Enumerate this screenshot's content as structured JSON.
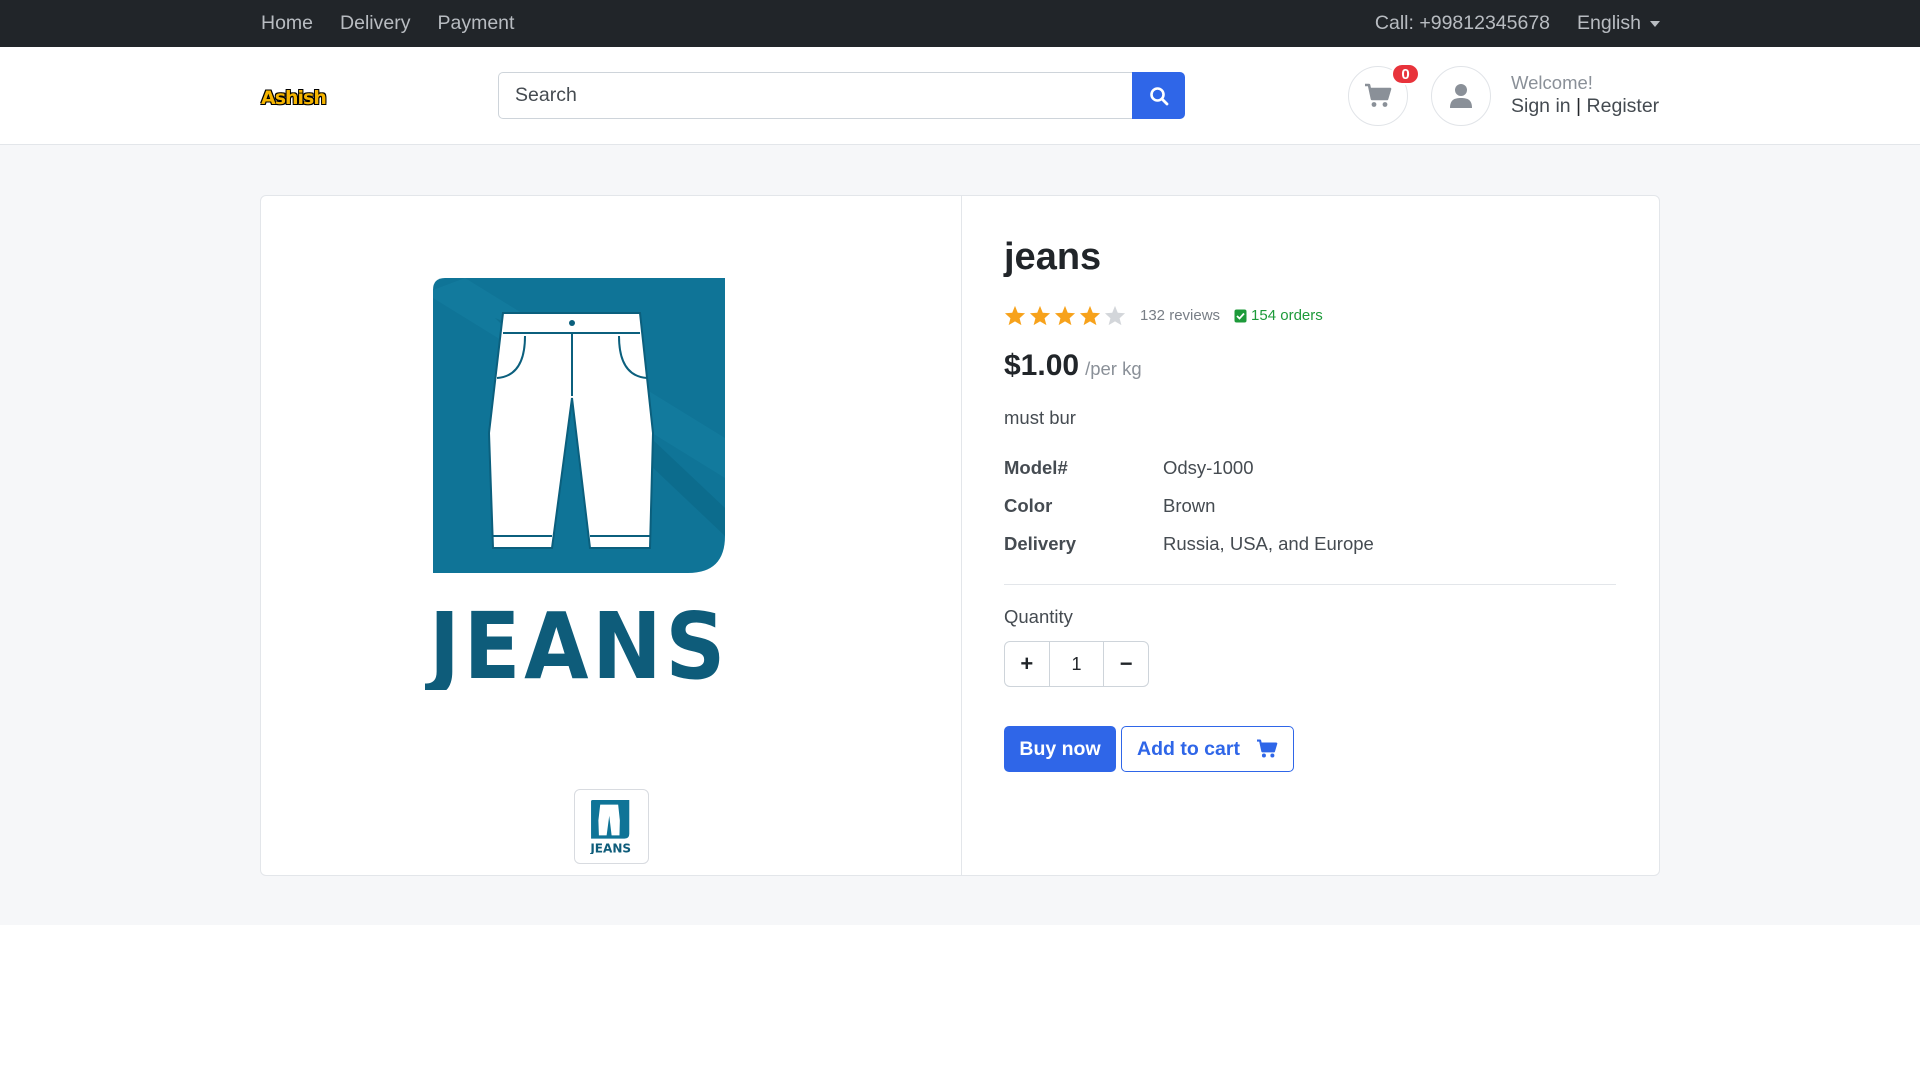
{
  "topbar": {
    "nav": [
      "Home",
      "Delivery",
      "Payment"
    ],
    "call": "Call: +99812345678",
    "language": "English"
  },
  "header": {
    "logo_text": "Ashish",
    "search_placeholder": "Search",
    "cart_count": "0",
    "welcome": "Welcome!",
    "sign_in": "Sign in",
    "separator": "|",
    "register": "Register"
  },
  "product": {
    "title": "jeans",
    "rating_stars": 4,
    "rating_max": 5,
    "reviews": "132 reviews",
    "orders": "154 orders",
    "price": "$1.00",
    "price_unit": "/per kg",
    "description": "must bur",
    "specs": [
      {
        "key": "Model#",
        "value": "Odsy-1000"
      },
      {
        "key": "Color",
        "value": "Brown"
      },
      {
        "key": "Delivery",
        "value": "Russia, USA, and Europe"
      }
    ],
    "quantity_label": "Quantity",
    "quantity_value": "1",
    "qty_plus": "+",
    "qty_minus": "−",
    "buy_now": "Buy now",
    "add_to_cart": "Add to cart",
    "image_text": "JEANS"
  },
  "colors": {
    "primary": "#2f66e8",
    "topbar": "#212529",
    "star": "#f7a21b",
    "star_empty": "#d3d6da",
    "badge": "#e8333b",
    "orders_green": "#1d9a3a",
    "jeans_teal": "#0e6a8d"
  },
  "icons": [
    "search-icon",
    "cart-icon",
    "user-icon",
    "star-icon",
    "check-icon"
  ]
}
